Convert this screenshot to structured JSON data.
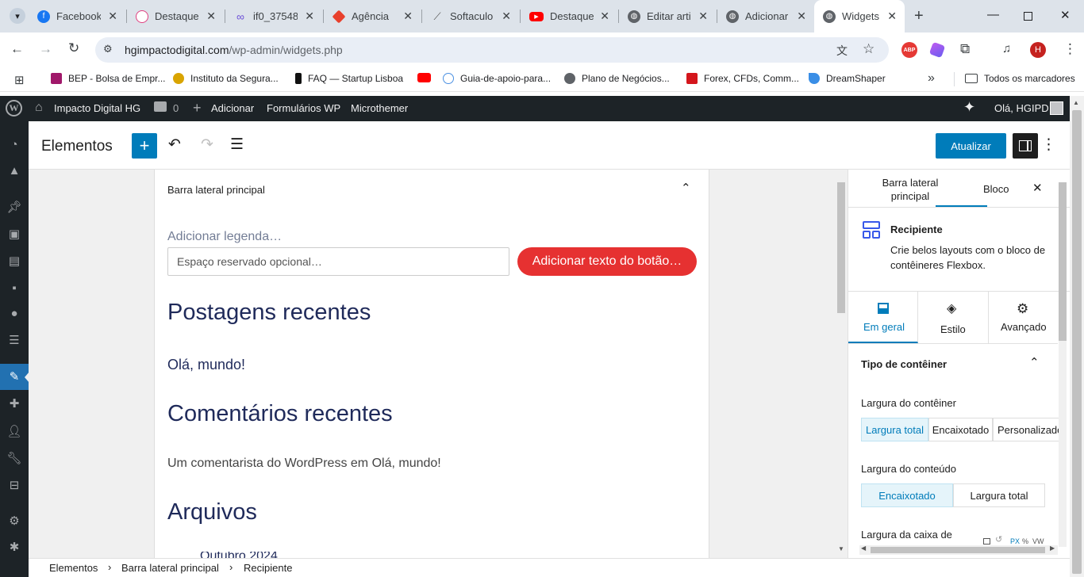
{
  "browser": {
    "tabs": [
      {
        "label": "Facebook",
        "color": "#1877f2"
      },
      {
        "label": "Destaque",
        "color": "#e04080"
      },
      {
        "label": "if0_37548",
        "color": "#6c4fd8"
      },
      {
        "label": "Agência",
        "color": "#e8402c"
      },
      {
        "label": "Softaculo",
        "color": "#7a7a7a"
      },
      {
        "label": "Destaque",
        "color": "#ff0000"
      },
      {
        "label": "Editar arti",
        "color": "#5f6368"
      },
      {
        "label": "Adicionar",
        "color": "#5f6368"
      },
      {
        "label": "Widgets",
        "color": "#5f6368"
      }
    ],
    "url_host": "hgimpactodigital.com",
    "url_path": "/wp-admin/widgets.php",
    "profile_initial": "H",
    "abp_label": "ABP",
    "bookmarks": [
      {
        "label": "BEP - Bolsa de Empr...",
        "color": "#a0186a"
      },
      {
        "label": "Instituto da Segura...",
        "color": "#d9a400"
      },
      {
        "label": "FAQ — Startup Lisboa",
        "color": "#111111"
      },
      {
        "label": "",
        "color": "#ff0000"
      },
      {
        "label": "Guia-de-apoio-para...",
        "color": "#4a90e2"
      },
      {
        "label": "Plano de Negócios...",
        "color": "#5f6368"
      },
      {
        "label": "Forex, CFDs, Comm...",
        "color": "#d4161c"
      },
      {
        "label": "DreamShaper",
        "color": "#3a8ee6"
      }
    ],
    "all_bookmarks": "Todos os marcadores",
    "more_bookmarks": "»"
  },
  "adminbar": {
    "site_name": "Impacto Digital HG",
    "comments_count": "0",
    "add_label": "Adicionar",
    "forms_label": "Formulários WP",
    "microthemer_label": "Microthemer",
    "greeting": "Olá, HGIPD"
  },
  "editor": {
    "title": "Elementos",
    "update_label": "Atualizar",
    "sidebar_title": "Barra lateral principal",
    "caption_placeholder": "Adicionar legenda…",
    "search_placeholder": "Espaço reservado opcional…",
    "search_button": "Adicionar texto do botão…",
    "recent_posts_heading": "Postagens recentes",
    "recent_post_item": "Olá, mundo!",
    "recent_comments_heading": "Comentários recentes",
    "comment_author": "Um comentarista do WordPress",
    "comment_on": "em",
    "comment_post": "Olá, mundo!",
    "archives_heading": "Arquivos",
    "archive_item": "Outubro 2024"
  },
  "inspector": {
    "tab_sidebar": "Barra lateral principal",
    "tab_block": "Bloco",
    "block_name": "Recipiente",
    "block_desc": "Crie belos layouts com o bloco de contêineres Flexbox.",
    "subtabs": [
      "Em geral",
      "Estilo",
      "Avançado"
    ],
    "section_title": "Tipo de contêiner",
    "container_width_label": "Largura do contêiner",
    "container_width_options": [
      "Largura total",
      "Encaixotado",
      "Personalizado"
    ],
    "content_width_label": "Largura do conteúdo",
    "content_width_options": [
      "Encaixotado",
      "Largura total"
    ],
    "box_width_label": "Largura da caixa de",
    "units": [
      "PX",
      "%",
      "VW"
    ]
  },
  "breadcrumb": [
    "Elementos",
    "Barra lateral principal",
    "Recipiente"
  ],
  "colors": {
    "wp_blue": "#007cba",
    "admin_dark": "#1d2327",
    "search_red": "#e63131",
    "heading_navy": "#1f2a5a",
    "active_blue": "#2271b1"
  }
}
